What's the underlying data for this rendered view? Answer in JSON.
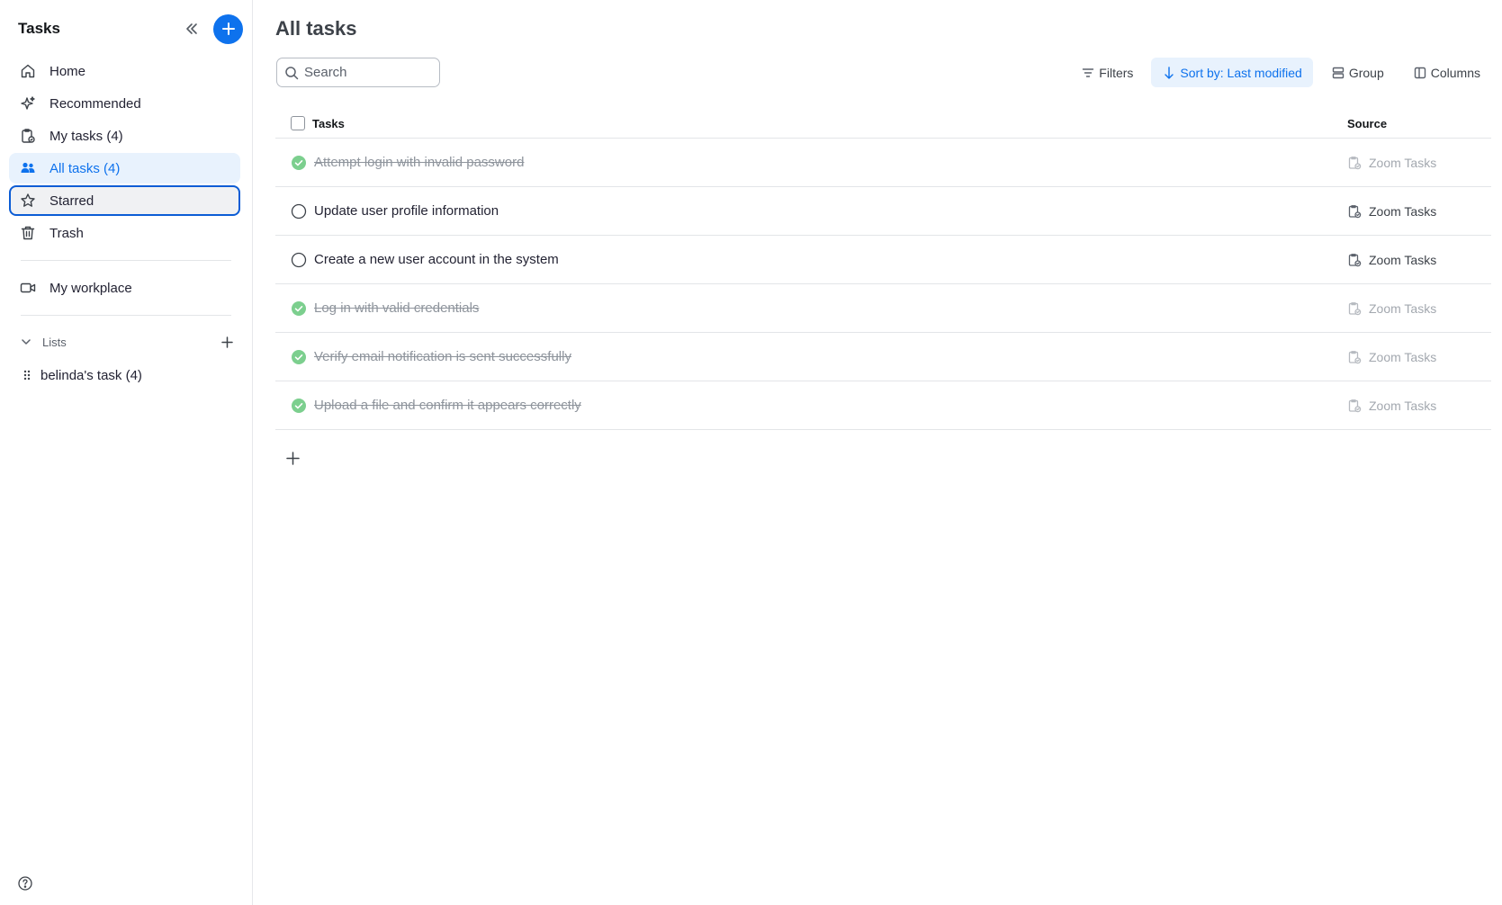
{
  "app": {
    "title": "Tasks"
  },
  "sidebar": {
    "items": [
      {
        "label": "Home",
        "icon": "home-icon"
      },
      {
        "label": "Recommended",
        "icon": "sparkle-icon"
      },
      {
        "label": "My tasks (4)",
        "icon": "my-tasks-icon"
      },
      {
        "label": "All tasks (4)",
        "icon": "people-icon",
        "active": true
      },
      {
        "label": "Starred",
        "icon": "star-icon",
        "focused": true
      },
      {
        "label": "Trash",
        "icon": "trash-icon"
      }
    ],
    "workplace": {
      "label": "My workplace",
      "icon": "video-icon"
    },
    "lists": {
      "header": "Lists",
      "items": [
        {
          "label": "belinda's task (4)"
        }
      ]
    }
  },
  "main": {
    "title": "All tasks",
    "search": {
      "placeholder": "Search",
      "value": ""
    },
    "toolbar": {
      "filters": "Filters",
      "sort": "Sort by: Last modified",
      "group": "Group",
      "columns": "Columns"
    },
    "table": {
      "headers": {
        "tasks": "Tasks",
        "source": "Source"
      },
      "rows": [
        {
          "name": "Attempt login with invalid password",
          "source": "Zoom Tasks",
          "completed": true
        },
        {
          "name": "Update user profile information",
          "source": "Zoom Tasks",
          "completed": false
        },
        {
          "name": "Create a new user account in the system",
          "source": "Zoom Tasks",
          "completed": false
        },
        {
          "name": "Log in with valid credentials",
          "source": "Zoom Tasks",
          "completed": true
        },
        {
          "name": "Verify email notification is sent successfully",
          "source": "Zoom Tasks",
          "completed": true
        },
        {
          "name": "Upload a file and confirm it appears correctly",
          "source": "Zoom Tasks",
          "completed": true
        }
      ]
    }
  },
  "colors": {
    "accent": "#0e72ed",
    "active_bg": "#e8f2fd",
    "complete_green": "#7ccf8e",
    "border": "#e3e5e8"
  }
}
